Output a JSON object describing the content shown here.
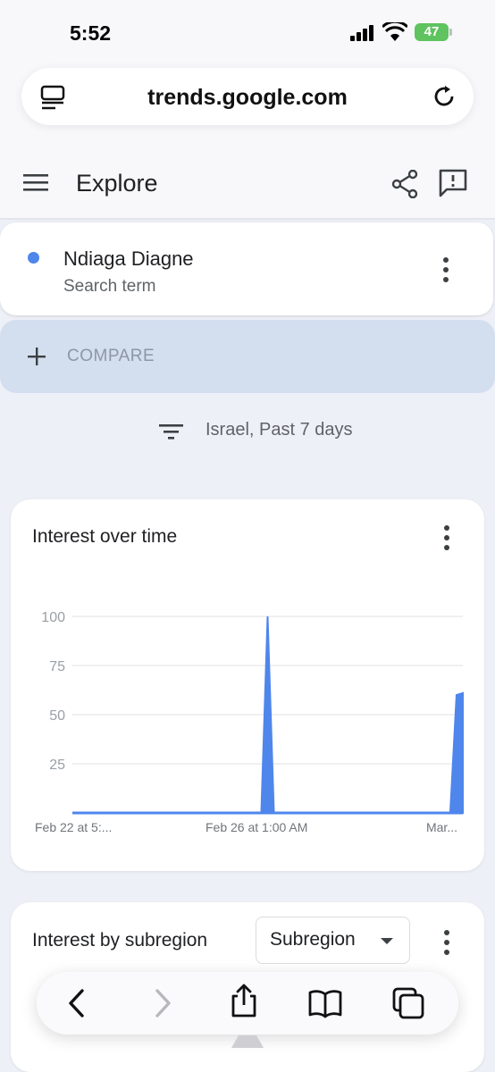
{
  "status_bar": {
    "time": "5:52",
    "battery": "47"
  },
  "browser": {
    "url": "trends.google.com"
  },
  "header": {
    "title": "Explore"
  },
  "search_term": {
    "name": "Ndiaga Diagne",
    "subtitle": "Search term",
    "color": "#4f86ec"
  },
  "compare": {
    "label": "COMPARE"
  },
  "filter": {
    "label": "Israel, Past 7 days"
  },
  "interest_over_time": {
    "title": "Interest over time",
    "chart_data": {
      "type": "area",
      "title": "Interest over time",
      "y_ticks": [
        "100",
        "75",
        "50",
        "25"
      ],
      "x_tick_labels": [
        "Feb 22 at 5:...",
        "Feb 26 at 1:00 AM",
        "Mar..."
      ],
      "ylim": [
        0,
        100
      ],
      "grid": true,
      "series": [
        {
          "color": "#4f86ec",
          "x": [
            0,
            30,
            31,
            32,
            60,
            61,
            62
          ],
          "values": [
            0,
            0,
            100,
            0,
            0,
            60,
            61
          ]
        }
      ]
    }
  },
  "subregion": {
    "title": "Interest by subregion",
    "select_value": "Subregion"
  }
}
